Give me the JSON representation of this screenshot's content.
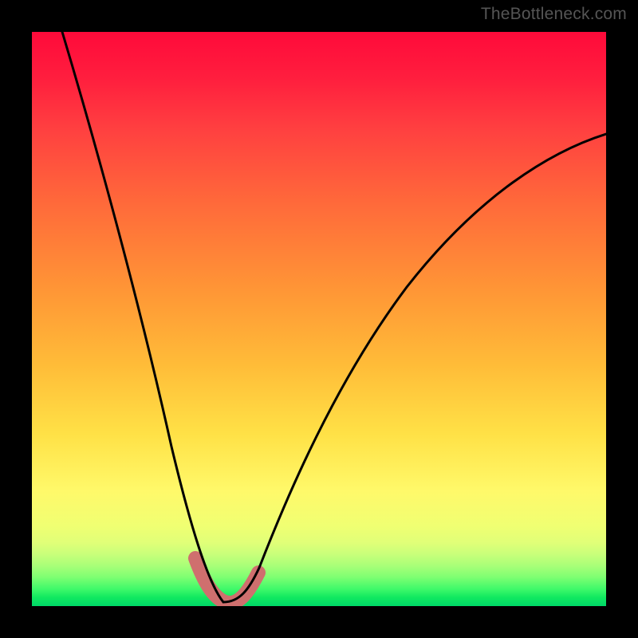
{
  "watermark": "TheBottleneck.com",
  "colors": {
    "frame": "#000000",
    "curve": "#000000",
    "fat_curve": "#cf6f6e",
    "gradient_stops": [
      "#ff0a3a",
      "#ff1e3e",
      "#ff4040",
      "#ff6a3a",
      "#ff9636",
      "#ffbc38",
      "#ffe146",
      "#fff96a",
      "#f0ff72",
      "#e0ff78",
      "#c8ff7a",
      "#a8ff78",
      "#7dff72",
      "#40f96a",
      "#10e860",
      "#00d968"
    ]
  },
  "chart_data": {
    "type": "line",
    "title": "",
    "xlabel": "",
    "ylabel": "",
    "xlim": [
      0,
      100
    ],
    "ylim": [
      0,
      100
    ],
    "series": [
      {
        "name": "bottleneck-curve",
        "x": [
          0,
          5,
          10,
          15,
          20,
          23,
          26,
          28,
          30,
          31.5,
          33,
          34.5,
          36,
          38,
          42,
          48,
          55,
          62,
          70,
          78,
          86,
          94,
          100
        ],
        "values": [
          100,
          85,
          67,
          48,
          30,
          20,
          12,
          7,
          3,
          1,
          0,
          0,
          1,
          3,
          9,
          20,
          32,
          44,
          55,
          64,
          72,
          78,
          82
        ]
      },
      {
        "name": "highlight-band",
        "x": [
          28,
          30,
          31.5,
          33,
          34.5,
          36,
          38
        ],
        "values": [
          7,
          3,
          1,
          0,
          1,
          3,
          7
        ]
      }
    ],
    "notes": "Smooth V-shaped curve on rainbow vertical gradient; minimum around x≈33 at y≈0. Axis ticks not shown; values estimated from pixel positions in a 0–100 normalized space."
  }
}
